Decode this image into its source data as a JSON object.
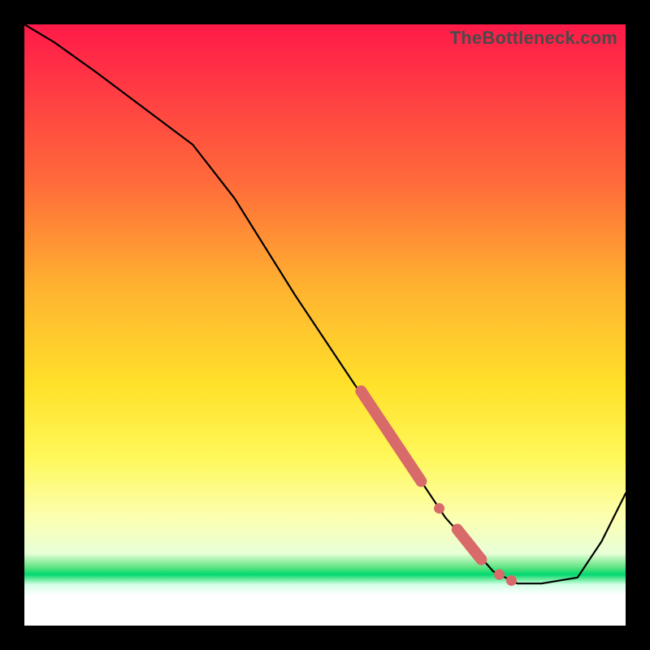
{
  "watermark": "TheBottleneck.com",
  "colors": {
    "frame": "#000000",
    "curve": "#000000",
    "marker": "#d96a6a"
  },
  "chart_data": {
    "type": "line",
    "title": "",
    "xlabel": "",
    "ylabel": "",
    "xlim": [
      0,
      100
    ],
    "ylim": [
      0,
      100
    ],
    "grid": false,
    "legend": false,
    "annotations": [
      "TheBottleneck.com"
    ],
    "series": [
      {
        "name": "curve",
        "x": [
          0,
          5,
          12,
          20,
          28,
          35,
          45,
          55,
          62,
          70,
          78,
          82,
          86,
          92,
          96,
          100
        ],
        "y": [
          100,
          97,
          92,
          86,
          80,
          71,
          55,
          40,
          30,
          18,
          9,
          7,
          7,
          8,
          14,
          22
        ]
      }
    ],
    "markers": {
      "capsules": [
        {
          "x1": 56,
          "y1": 39,
          "x2": 66,
          "y2": 24
        },
        {
          "x1": 72,
          "y1": 16,
          "x2": 76,
          "y2": 11
        }
      ],
      "dots": [
        {
          "x": 69.0,
          "y": 19.5
        },
        {
          "x": 79.0,
          "y": 8.5
        },
        {
          "x": 81.0,
          "y": 7.5
        }
      ]
    }
  }
}
